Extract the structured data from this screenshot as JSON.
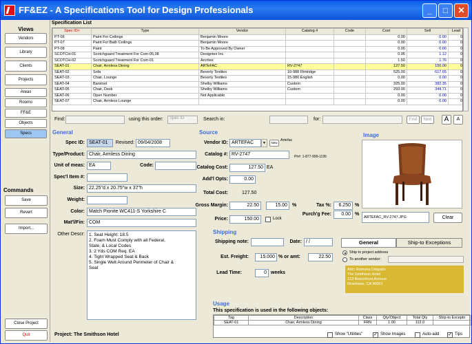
{
  "window": {
    "title": "FF&EZ - A Specifications Tool for Design Professionals"
  },
  "nav": {
    "views_label": "Views",
    "items": [
      "Vendors",
      "Library",
      "Clients",
      "Projects",
      "Areas",
      "Rooms",
      "FF&E",
      "Objects",
      "Specs"
    ],
    "commands_label": "Commands",
    "save": "Save",
    "revert": "Revert",
    "import": "Import...",
    "close_project": "Close Project",
    "quit": "Quit"
  },
  "spec_list": {
    "title": "Specification List",
    "columns": [
      "Spec ID>",
      "Type",
      "Vendor",
      "Catalog #",
      "Code",
      "Cost",
      "Sell",
      "Lead"
    ],
    "rows": [
      [
        "PT-06",
        "Paint For Ceilings",
        "Benjamin Moore",
        "",
        "",
        "0.00",
        "0.00",
        "0"
      ],
      [
        "PT-07",
        "Paint For Bath Ceilings",
        "Benjamin Moore",
        "",
        "",
        "0.00",
        "0.00",
        "0"
      ],
      [
        "PT-08",
        "Paint",
        "To Be Approved By Owner",
        "",
        "",
        "0.00",
        "0.00",
        "0"
      ],
      [
        "SCOTCH-01",
        "Scotchguard Treatment For Com-05,08",
        "Designtex Inc",
        "",
        "",
        "0.95",
        "1.12",
        "0"
      ],
      [
        "SCOTCH-02",
        "Scotchguard Treatment For Com-01",
        "Arcritex",
        "",
        "",
        "1.50",
        "1.76",
        "0"
      ],
      [
        "SEAT-01",
        "Chair, Armless Dining",
        "ARTeFAC",
        "RV-2747",
        "",
        "127.50",
        "150.00",
        "0"
      ],
      [
        "SEAT-02",
        "Sofa",
        "Beverly Textiles",
        "10-988 Flintridge",
        "",
        "525.00",
        "617.65",
        "0"
      ],
      [
        "SEAT-03",
        "Chair, Lounge",
        "Beverly Textiles",
        "15-980 English",
        "",
        "0.00",
        "0.00",
        "0"
      ],
      [
        "SEAT-04",
        "Barstool",
        "Shelby Williams",
        "Custom",
        "",
        "325.00",
        "382.35",
        "0"
      ],
      [
        "SEAT-05",
        "Chair, Desk",
        "Shelby Williams",
        "Custom",
        "",
        "293.00",
        "344.71",
        "0"
      ],
      [
        "SEAT-06",
        "Open Number",
        "Not Applicable",
        "",
        "",
        "0.00",
        "0.00",
        "0"
      ],
      [
        "SEAT-07",
        "Chair, Armless Lounge",
        "",
        "",
        "",
        "0.00",
        "0.00",
        "0"
      ]
    ],
    "selected_row": 5
  },
  "find": {
    "find_label": "Find:",
    "order_label": "using this order:",
    "order_value": "Spec ID",
    "search_label": "Search in:",
    "for_label": "for:",
    "find_btn": "Find",
    "next_btn": "Next"
  },
  "general": {
    "header": "General",
    "spec_id_label": "Spec ID:",
    "spec_id": "SEAT-01",
    "revised_label": "Revised:",
    "revised": "09/04/2008",
    "type_label": "Type/Product:",
    "type": "Chair, Armless Dining",
    "unit_label": "Unit of meas:",
    "unit": "EA",
    "code_label": "Code:",
    "code": "",
    "specl_label": "Spec'l Item #:",
    "specl": "",
    "size_label": "Size:",
    "size": "22.25\"d x 20.75\"w x 37\"h",
    "weight_label": "Weight:",
    "weight": "",
    "color_label": "Color:",
    "color": "Match Pionite WC411-S Yorkshire C",
    "matl_label": "Mat'l/Fin:",
    "matl": "COM",
    "other_label": "Other Descr:",
    "other_lines": [
      "1. Seat Height: 18.5",
      "2. Foam Must Comply with all Federal,",
      "State, & Local Codes",
      "3. 2 Yds COM Req. EA",
      "4. Tight Wrapped Seat & Back",
      "5. Single Welt Around Perimeter of Chair &",
      "Seat"
    ]
  },
  "source": {
    "header": "Source",
    "vendor_label": "Vendor ID:",
    "vendor": "ARTEFAC",
    "new_btn": "New",
    "vendor_name": "Artefac",
    "catalog_label": "Catalog #:",
    "catalog": "RV-2747",
    "phone": "Ph#: 1-877-999-1195",
    "cost_label": "Catalog Cost:",
    "cost": "127.50",
    "cost_unit": "EA",
    "addl_label": "Add'l Opts:",
    "addl": "0.00",
    "total_label": "Total Cost:",
    "total": "127.50",
    "margin_label": "Gross Margin:",
    "margin": "22.50",
    "margin_pct": "15.00",
    "pct": "%",
    "tax_label": "Tax %:",
    "tax": "6.250",
    "tax_pct": "%",
    "price_label": "Price:",
    "price": "150.00",
    "lock_label": "Lock",
    "purch_label": "Purch'g Fee:",
    "purch": "0.00",
    "purch_pct": "%"
  },
  "image": {
    "header": "Image",
    "filename": "ARTEFAC_RV-2747.JPG",
    "clear_btn": "Clear"
  },
  "shipping": {
    "header": "Shipping",
    "note_label": "Shipping note:",
    "note": "",
    "date_label": "Date:",
    "date": " /  /",
    "freight_label": "Est. Freight:",
    "freight_pct": "15.000",
    "or_amt": "% or amt:",
    "freight_amt": "22.50",
    "lead_label": "Lead Time:",
    "lead": "0",
    "weeks": "weeks",
    "tab_general": "General",
    "tab_exceptions": "Ship-to Exceptions",
    "radio1": "Ship to project address",
    "radio2": "To another vendor:",
    "address": [
      "Attn: Ramona Delgado",
      "The Smithson Hotel",
      "123 Beachfront Avenue",
      "Rivertown, CA  90001"
    ]
  },
  "usage": {
    "header": "Usage",
    "note": "This specification is used in the following objects:",
    "columns": [
      "Tag",
      "Description",
      "Class",
      "Qty/Object",
      "Total Qty",
      "Ship-to Exceptn"
    ],
    "rows": [
      [
        "SEAT-01",
        "Chair, Armless Dining",
        "FRN",
        "1.00",
        "112.0",
        ""
      ]
    ]
  },
  "status": {
    "project": "Project: The Smithson Hotel",
    "show_utilities": "Show \"Utilities\"",
    "show_images": "Show Images",
    "auto_add": "Auto-add",
    "tips": "Tips"
  },
  "colors": {
    "accent": "#3b6ed6",
    "selection": "#ffff9c",
    "sell": "#0000cc",
    "sort_column": "#cc0000"
  }
}
